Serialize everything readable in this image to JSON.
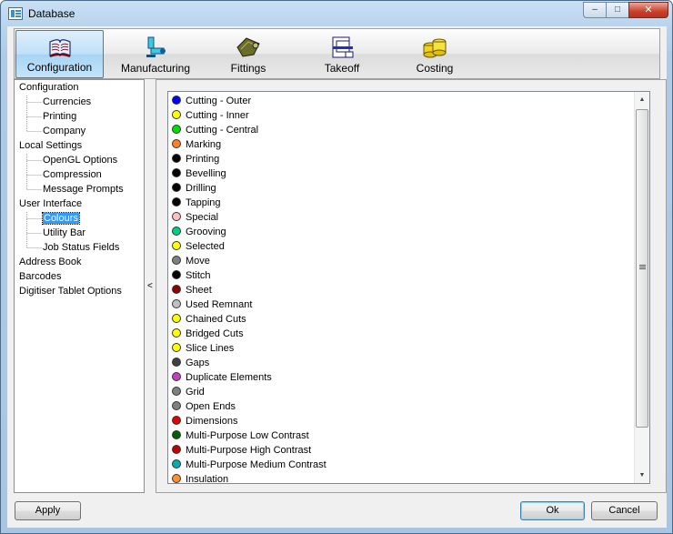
{
  "window": {
    "title": "Database"
  },
  "title_buttons": {
    "minimize": "–",
    "maximize": "□",
    "close": "✕"
  },
  "toolbar": {
    "buttons": [
      {
        "label": "Configuration",
        "icon": "book-icon",
        "active": true
      },
      {
        "label": "Manufacturing",
        "icon": "robot-arm-icon",
        "active": false
      },
      {
        "label": "Fittings",
        "icon": "fittings-icon",
        "active": false
      },
      {
        "label": "Takeoff",
        "icon": "takeoff-icon",
        "active": false
      },
      {
        "label": "Costing",
        "icon": "coins-icon",
        "active": false
      }
    ]
  },
  "tree": {
    "items": [
      {
        "label": "Configuration",
        "level": 0
      },
      {
        "label": "Currencies",
        "level": 1
      },
      {
        "label": "Printing",
        "level": 1
      },
      {
        "label": "Company",
        "level": 1
      },
      {
        "label": "Local Settings",
        "level": 0
      },
      {
        "label": "OpenGL Options",
        "level": 1
      },
      {
        "label": "Compression",
        "level": 1
      },
      {
        "label": "Message Prompts",
        "level": 1
      },
      {
        "label": "User Interface",
        "level": 0
      },
      {
        "label": "Colours",
        "level": 1,
        "selected": true
      },
      {
        "label": "Utility Bar",
        "level": 1
      },
      {
        "label": "Job Status Fields",
        "level": 1
      },
      {
        "label": "Address Book",
        "level": 0
      },
      {
        "label": "Barcodes",
        "level": 0
      },
      {
        "label": "Digitiser Tablet Options",
        "level": 0
      }
    ]
  },
  "splitter": {
    "arrow": "<"
  },
  "colours": [
    {
      "label": "Cutting - Outer",
      "color": "#0000ff"
    },
    {
      "label": "Cutting - Inner",
      "color": "#ffff00"
    },
    {
      "label": "Cutting - Central",
      "color": "#00e000"
    },
    {
      "label": "Marking",
      "color": "#ff7f27"
    },
    {
      "label": "Printing",
      "color": "#000000"
    },
    {
      "label": "Bevelling",
      "color": "#000000"
    },
    {
      "label": "Drilling",
      "color": "#000000"
    },
    {
      "label": "Tapping",
      "color": "#000000"
    },
    {
      "label": "Special",
      "color": "#ffc0c0"
    },
    {
      "label": "Grooving",
      "color": "#00d080"
    },
    {
      "label": "Selected",
      "color": "#ffff00"
    },
    {
      "label": "Move",
      "color": "#808080"
    },
    {
      "label": "Stitch",
      "color": "#000000"
    },
    {
      "label": "Sheet",
      "color": "#8b0000"
    },
    {
      "label": "Used Remnant",
      "color": "#c0c0c0"
    },
    {
      "label": "Chained Cuts",
      "color": "#ffff00"
    },
    {
      "label": "Bridged Cuts",
      "color": "#ffff00"
    },
    {
      "label": "Slice Lines",
      "color": "#ffff00"
    },
    {
      "label": "Gaps",
      "color": "#404040"
    },
    {
      "label": "Duplicate Elements",
      "color": "#c040c0"
    },
    {
      "label": "Grid",
      "color": "#808080"
    },
    {
      "label": "Open Ends",
      "color": "#808080"
    },
    {
      "label": "Dimensions",
      "color": "#e00000"
    },
    {
      "label": "Multi-Purpose Low Contrast",
      "color": "#006000"
    },
    {
      "label": "Multi-Purpose High Contrast",
      "color": "#c00000"
    },
    {
      "label": "Multi-Purpose Medium Contrast",
      "color": "#00b0b0"
    },
    {
      "label": "Insulation",
      "color": "#ff9030"
    }
  ],
  "buttons": {
    "apply": "Apply",
    "ok": "Ok",
    "cancel": "Cancel"
  }
}
